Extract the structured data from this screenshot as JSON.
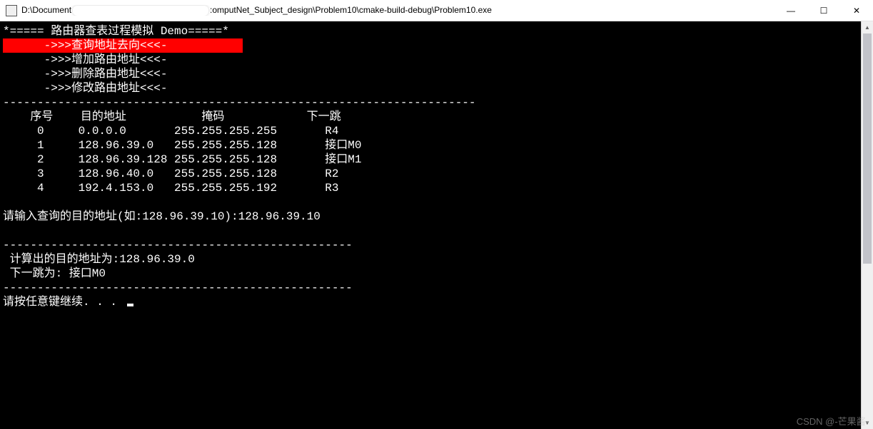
{
  "window": {
    "title_prefix": "D:\\Document",
    "title_suffix": ":omputNet_Subject_design\\Problem10\\cmake-build-debug\\Problem10.exe",
    "minimize": "—",
    "maximize": "☐",
    "close": "✕"
  },
  "console": {
    "header": "*===== 路由器查表过程模拟 Demo=====*",
    "menu": {
      "selected": "      ->>>查询地址去向<<<-           ",
      "items": [
        "      ->>>增加路由地址<<<-",
        "      ->>>删除路由地址<<<-",
        "      ->>>修改路由地址<<<-"
      ]
    },
    "sep1": "---------------------------------------------------------------------",
    "table": {
      "header": "    序号    目的地址           掩码            下一跳",
      "rows": [
        "     0     0.0.0.0       255.255.255.255       R4",
        "     1     128.96.39.0   255.255.255.128       接口M0",
        "     2     128.96.39.128 255.255.255.128       接口M1",
        "     3     128.96.40.0   255.255.255.128       R2",
        "     4     192.4.153.0   255.255.255.192       R3"
      ]
    },
    "prompt_line": "请输入查询的目的地址(如:128.96.39.10):128.96.39.10",
    "sep2": "---------------------------------------------------",
    "result1": " 计算出的目的地址为:128.96.39.0",
    "result2": " 下一跳为: 接口M0",
    "sep3": "---------------------------------------------------",
    "press_key": "请按任意键继续. . . "
  },
  "watermark": "CSDN @-芒果酱-"
}
